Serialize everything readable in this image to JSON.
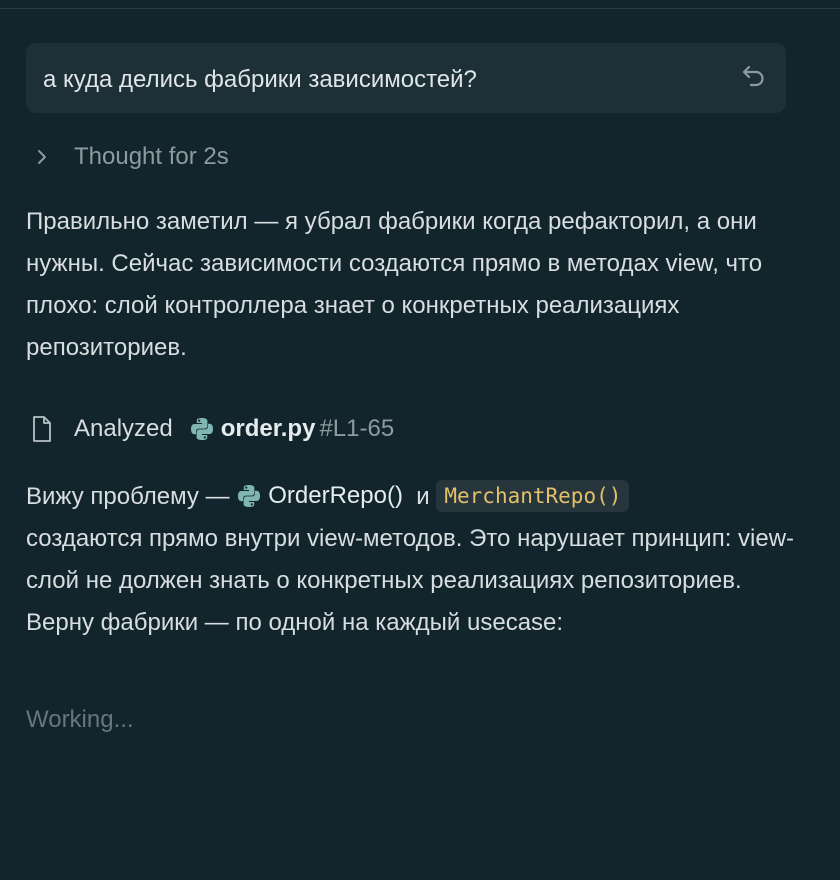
{
  "user_message": {
    "text": "а куда делись фабрики зависимостей?"
  },
  "thought": {
    "label": "Thought for 2s"
  },
  "response_paragraph_1": "Правильно заметил — я убрал фабрики когда рефакторил, а они нужны. Сейчас зависимости создаются прямо в методах view, что плохо: слой контроллера знает о конкретных реализациях репозиториев.",
  "analyzed": {
    "label": "Analyzed",
    "file_name": "order.py",
    "line_range": "#L1-65"
  },
  "response_paragraph_2": {
    "prefix": "Вижу проблему — ",
    "ref_1": "OrderRepo()",
    "connector": "и",
    "code_2": "MerchantRepo()",
    "suffix": "создаются прямо внутри view-методов. Это нарушает принцип: view-слой не должен знать о конкретных реализациях репозиториев. Верну фабрики — по одной на каждый usecase:"
  },
  "status": {
    "text": "Working..."
  },
  "icons": {
    "undo": "undo-icon",
    "chevron": "chevron-right-icon",
    "file": "file-icon",
    "python": "python-icon"
  },
  "colors": {
    "background": "#13252c",
    "bubble": "#1e3037",
    "code_text": "#e4c06a",
    "muted": "#8e9a9f",
    "python_icon": "#7fb6b3"
  }
}
